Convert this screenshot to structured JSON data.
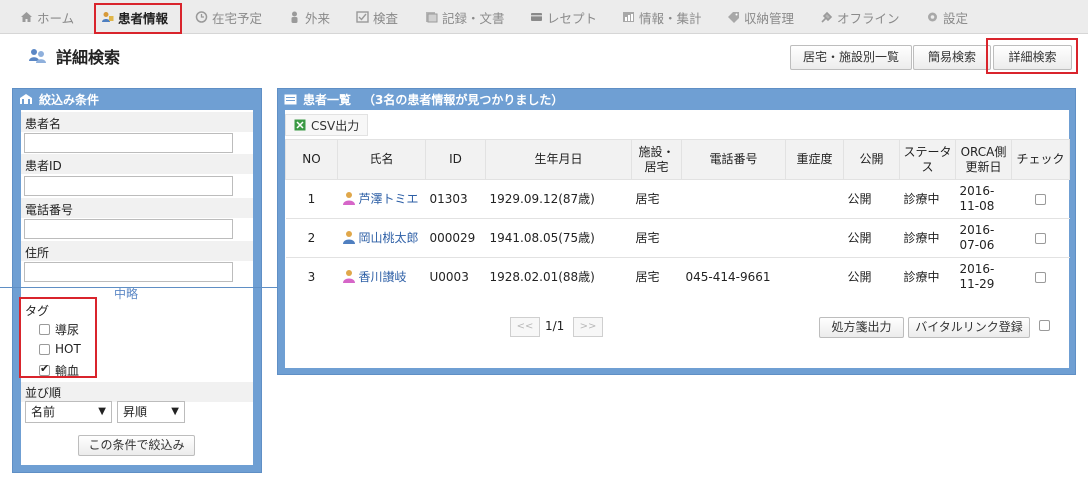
{
  "nav": {
    "items": [
      {
        "label": "ホーム",
        "icon": "home-icon"
      },
      {
        "label": "患者情報",
        "icon": "patient-icon",
        "active": true
      },
      {
        "label": "在宅予定",
        "icon": "clock-icon"
      },
      {
        "label": "外来",
        "icon": "person-icon"
      },
      {
        "label": "検査",
        "icon": "checklist-icon"
      },
      {
        "label": "記録・文書",
        "icon": "document-icon"
      },
      {
        "label": "レセプト",
        "icon": "receipt-icon"
      },
      {
        "label": "情報・集計",
        "icon": "chart-icon"
      },
      {
        "label": "収納管理",
        "icon": "tag-icon"
      },
      {
        "label": "オフライン",
        "icon": "plug-icon"
      },
      {
        "label": "設定",
        "icon": "gear-icon"
      }
    ]
  },
  "page": {
    "title": "詳細検索"
  },
  "view_buttons": {
    "facility": "居宅・施設別一覧",
    "simple": "簡易検索",
    "detail": "詳細検索"
  },
  "filter": {
    "header": "絞込み条件",
    "patient_name_label": "患者名",
    "patient_name_value": "",
    "patient_id_label": "患者ID",
    "patient_id_value": "",
    "phone_label": "電話番号",
    "phone_value": "",
    "address_label": "住所",
    "address_value": "",
    "middle_label": "中略",
    "tag_label": "タグ",
    "tags": [
      {
        "label": "導尿",
        "checked": false
      },
      {
        "label": "HOT",
        "checked": false
      },
      {
        "label": "輸血",
        "checked": true
      }
    ],
    "sort_label": "並び順",
    "sort_field": "名前",
    "sort_order": "昇順",
    "submit_label": "この条件で絞込み"
  },
  "results": {
    "header": "患者一覧",
    "count_text": "（3名の患者情報が見つかりました）",
    "csv_label": "CSV出力",
    "columns": [
      "NO",
      "氏名",
      "ID",
      "生年月日",
      "施設・居宅",
      "電話番号",
      "重症度",
      "公開",
      "ステータス",
      "ORCA側更新日",
      "チェック"
    ],
    "rows": [
      {
        "no": "1",
        "name": "芦澤トミエ",
        "id": "01303",
        "birth": "1929.09.12(87歳)",
        "facility": "居宅",
        "phone": "",
        "severity": "",
        "public": "公開",
        "status": "診療中",
        "orca": "2016-11-08"
      },
      {
        "no": "2",
        "name": "岡山桃太郎",
        "id": "000029",
        "birth": "1941.08.05(75歳)",
        "facility": "居宅",
        "phone": "",
        "severity": "",
        "public": "公開",
        "status": "診療中",
        "orca": "2016-07-06"
      },
      {
        "no": "3",
        "name": "香川讃岐",
        "id": "U0003",
        "birth": "1928.02.01(88歳)",
        "facility": "居宅",
        "phone": "045-414-9661",
        "severity": "",
        "public": "公開",
        "status": "診療中",
        "orca": "2016-11-29"
      }
    ],
    "pager": {
      "prev": "<<",
      "page": "1/1",
      "next": ">>"
    },
    "prescription_label": "処方箋出力",
    "vital_label": "バイタルリンク登録"
  }
}
